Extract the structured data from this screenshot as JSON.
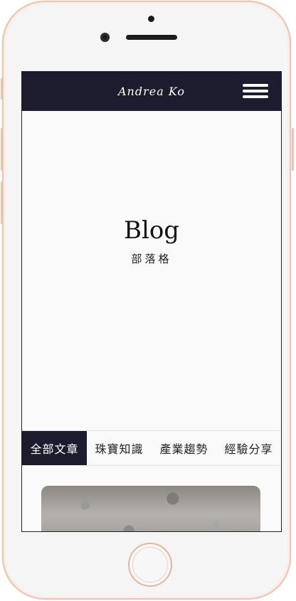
{
  "nav": {
    "logo": "Andrea Ko",
    "menu_icon": "hamburger-menu-icon"
  },
  "hero": {
    "title": "Blog",
    "subtitle": "部落格"
  },
  "tabs": [
    {
      "label": "全部文章",
      "active": true
    },
    {
      "label": "珠寶知識",
      "active": false
    },
    {
      "label": "產業趨勢",
      "active": false
    },
    {
      "label": "經驗分享",
      "active": false
    }
  ],
  "colors": {
    "nav_bg": "#1c1c2e",
    "active_tab_bg": "#1c1c2e",
    "phone_frame": "#eac7b4"
  }
}
